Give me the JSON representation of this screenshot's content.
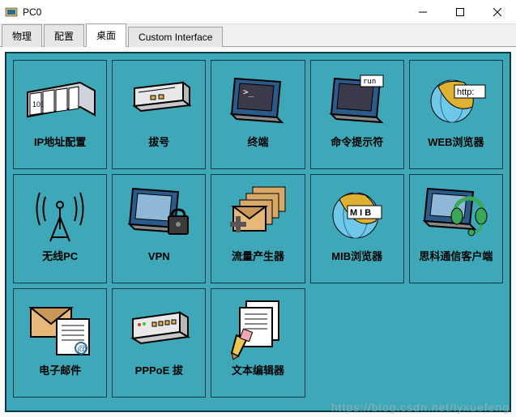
{
  "window": {
    "title": "PC0"
  },
  "tabs": [
    {
      "label": "物理"
    },
    {
      "label": "配置"
    },
    {
      "label": "桌面"
    },
    {
      "label": "Custom Interface"
    }
  ],
  "active_tab_index": 2,
  "apps": [
    {
      "label": "IP地址配置",
      "icon": "ip-config-icon"
    },
    {
      "label": "拔号",
      "icon": "dialup-icon"
    },
    {
      "label": "终端",
      "icon": "terminal-icon"
    },
    {
      "label": "命令提示符",
      "icon": "command-prompt-icon",
      "badge": "run"
    },
    {
      "label": "WEB浏览器",
      "icon": "web-browser-icon",
      "badge": "http:"
    },
    {
      "label": "无线PC",
      "icon": "wireless-pc-icon"
    },
    {
      "label": "VPN",
      "icon": "vpn-icon"
    },
    {
      "label": "流量产生器",
      "icon": "traffic-generator-icon"
    },
    {
      "label": "MIB浏览器",
      "icon": "mib-browser-icon",
      "badge": "M I B"
    },
    {
      "label": "思科通信客户端",
      "icon": "cisco-communicator-icon"
    },
    {
      "label": "电子邮件",
      "icon": "email-icon"
    },
    {
      "label": "PPPoE 拔",
      "icon": "pppoe-icon"
    },
    {
      "label": "文本编辑器",
      "icon": "text-editor-icon"
    }
  ],
  "watermark": "https://blog.csdn.net/lyxuefeng"
}
